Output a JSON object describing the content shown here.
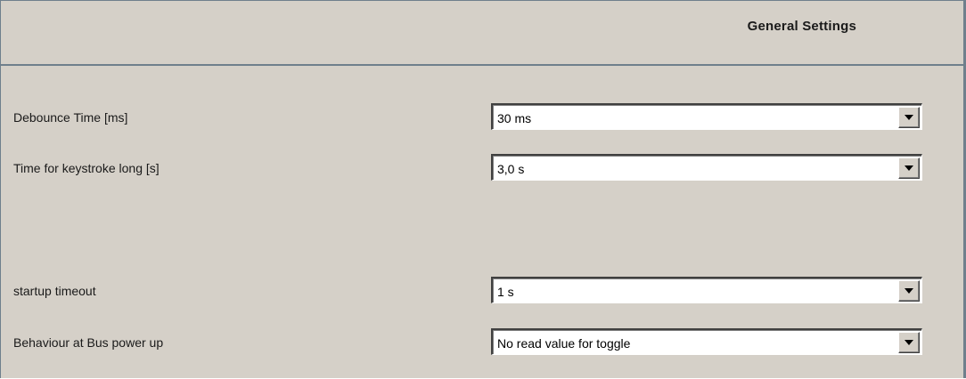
{
  "header": {
    "title": "General Settings"
  },
  "rows": [
    {
      "label": "Debounce Time [ms]",
      "value": "30 ms"
    },
    {
      "label": "Time for  keystroke long  [s]",
      "value": "3,0 s"
    },
    {
      "label": "startup timeout",
      "value": "1 s"
    },
    {
      "label": "Behaviour at Bus power up",
      "value": "No read value for toggle"
    }
  ],
  "icons": {
    "dropdown": "chevron-down-icon"
  }
}
